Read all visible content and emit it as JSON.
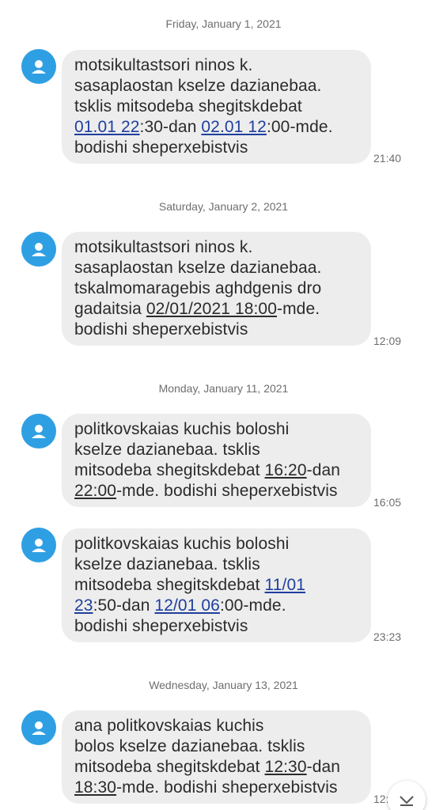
{
  "messages": [
    {
      "date": "Friday, January 1, 2021",
      "time": "21:40",
      "lines": [
        [
          {
            "t": "motsikultastsori ninos k."
          }
        ],
        [
          {
            "t": "sasaplaostan kselze dazianebaa."
          }
        ],
        [
          {
            "t": "tsklis mitsodeba shegitskdebat"
          }
        ],
        [
          {
            "t": "01.01 22",
            "link": "blue"
          },
          {
            "t": ":30-dan "
          },
          {
            "t": "02.01 12",
            "link": "blue"
          },
          {
            "t": ":00-mde."
          }
        ],
        [
          {
            "t": "bodishi sheperxebistvis"
          }
        ]
      ]
    },
    {
      "date": "Saturday, January 2, 2021",
      "time": "12:09",
      "lines": [
        [
          {
            "t": "motsikultastsori ninos k."
          }
        ],
        [
          {
            "t": "sasaplaostan kselze dazianebaa."
          }
        ],
        [
          {
            "t": "tskalmomaragebis aghdgenis dro"
          }
        ],
        [
          {
            "t": "gadaitsia "
          },
          {
            "t": "02/01/2021 18:00",
            "link": "dark"
          },
          {
            "t": "-mde."
          }
        ],
        [
          {
            "t": "bodishi sheperxebistvis"
          }
        ]
      ]
    },
    {
      "date": "Monday, January 11, 2021",
      "time": "16:05",
      "lines": [
        [
          {
            "t": "politkovskaias kuchis boloshi"
          }
        ],
        [
          {
            "t": "kselze dazianebaa. tsklis"
          }
        ],
        [
          {
            "t": "mitsodeba shegitskdebat "
          },
          {
            "t": "16:20",
            "link": "dark"
          },
          {
            "t": "-dan"
          }
        ],
        [
          {
            "t": "22:00",
            "link": "dark"
          },
          {
            "t": "-mde. bodishi sheperxebistvis"
          }
        ]
      ]
    },
    {
      "date": "",
      "time": "23:23",
      "lines": [
        [
          {
            "t": "politkovskaias kuchis boloshi"
          }
        ],
        [
          {
            "t": "kselze dazianebaa. tsklis"
          }
        ],
        [
          {
            "t": "mitsodeba shegitskdebat "
          },
          {
            "t": "11/01",
            "link": "blue"
          }
        ],
        [
          {
            "t": "23",
            "link": "blue"
          },
          {
            "t": ":50-dan "
          },
          {
            "t": "12/01 06",
            "link": "blue"
          },
          {
            "t": ":00-mde."
          }
        ],
        [
          {
            "t": "bodishi sheperxebistvis"
          }
        ]
      ]
    },
    {
      "date": "Wednesday, January 13, 2021",
      "time": "12:",
      "lines": [
        [
          {
            "t": "ana politkovskaias kuchis"
          }
        ],
        [
          {
            "t": "bolos kselze dazianebaa. tsklis"
          }
        ],
        [
          {
            "t": "mitsodeba shegitskdebat "
          },
          {
            "t": "12:30",
            "link": "dark"
          },
          {
            "t": "-dan"
          }
        ],
        [
          {
            "t": "18:30",
            "link": "dark"
          },
          {
            "t": "-mde. bodishi sheperxebistvis"
          }
        ]
      ]
    }
  ],
  "icons": {
    "avatar": "person-icon",
    "scroll": "chevron-down-icon"
  },
  "colors": {
    "avatar_bg": "#2f9fe3",
    "bubble_bg": "#ededed",
    "link_blue": "#1f3f9e"
  }
}
